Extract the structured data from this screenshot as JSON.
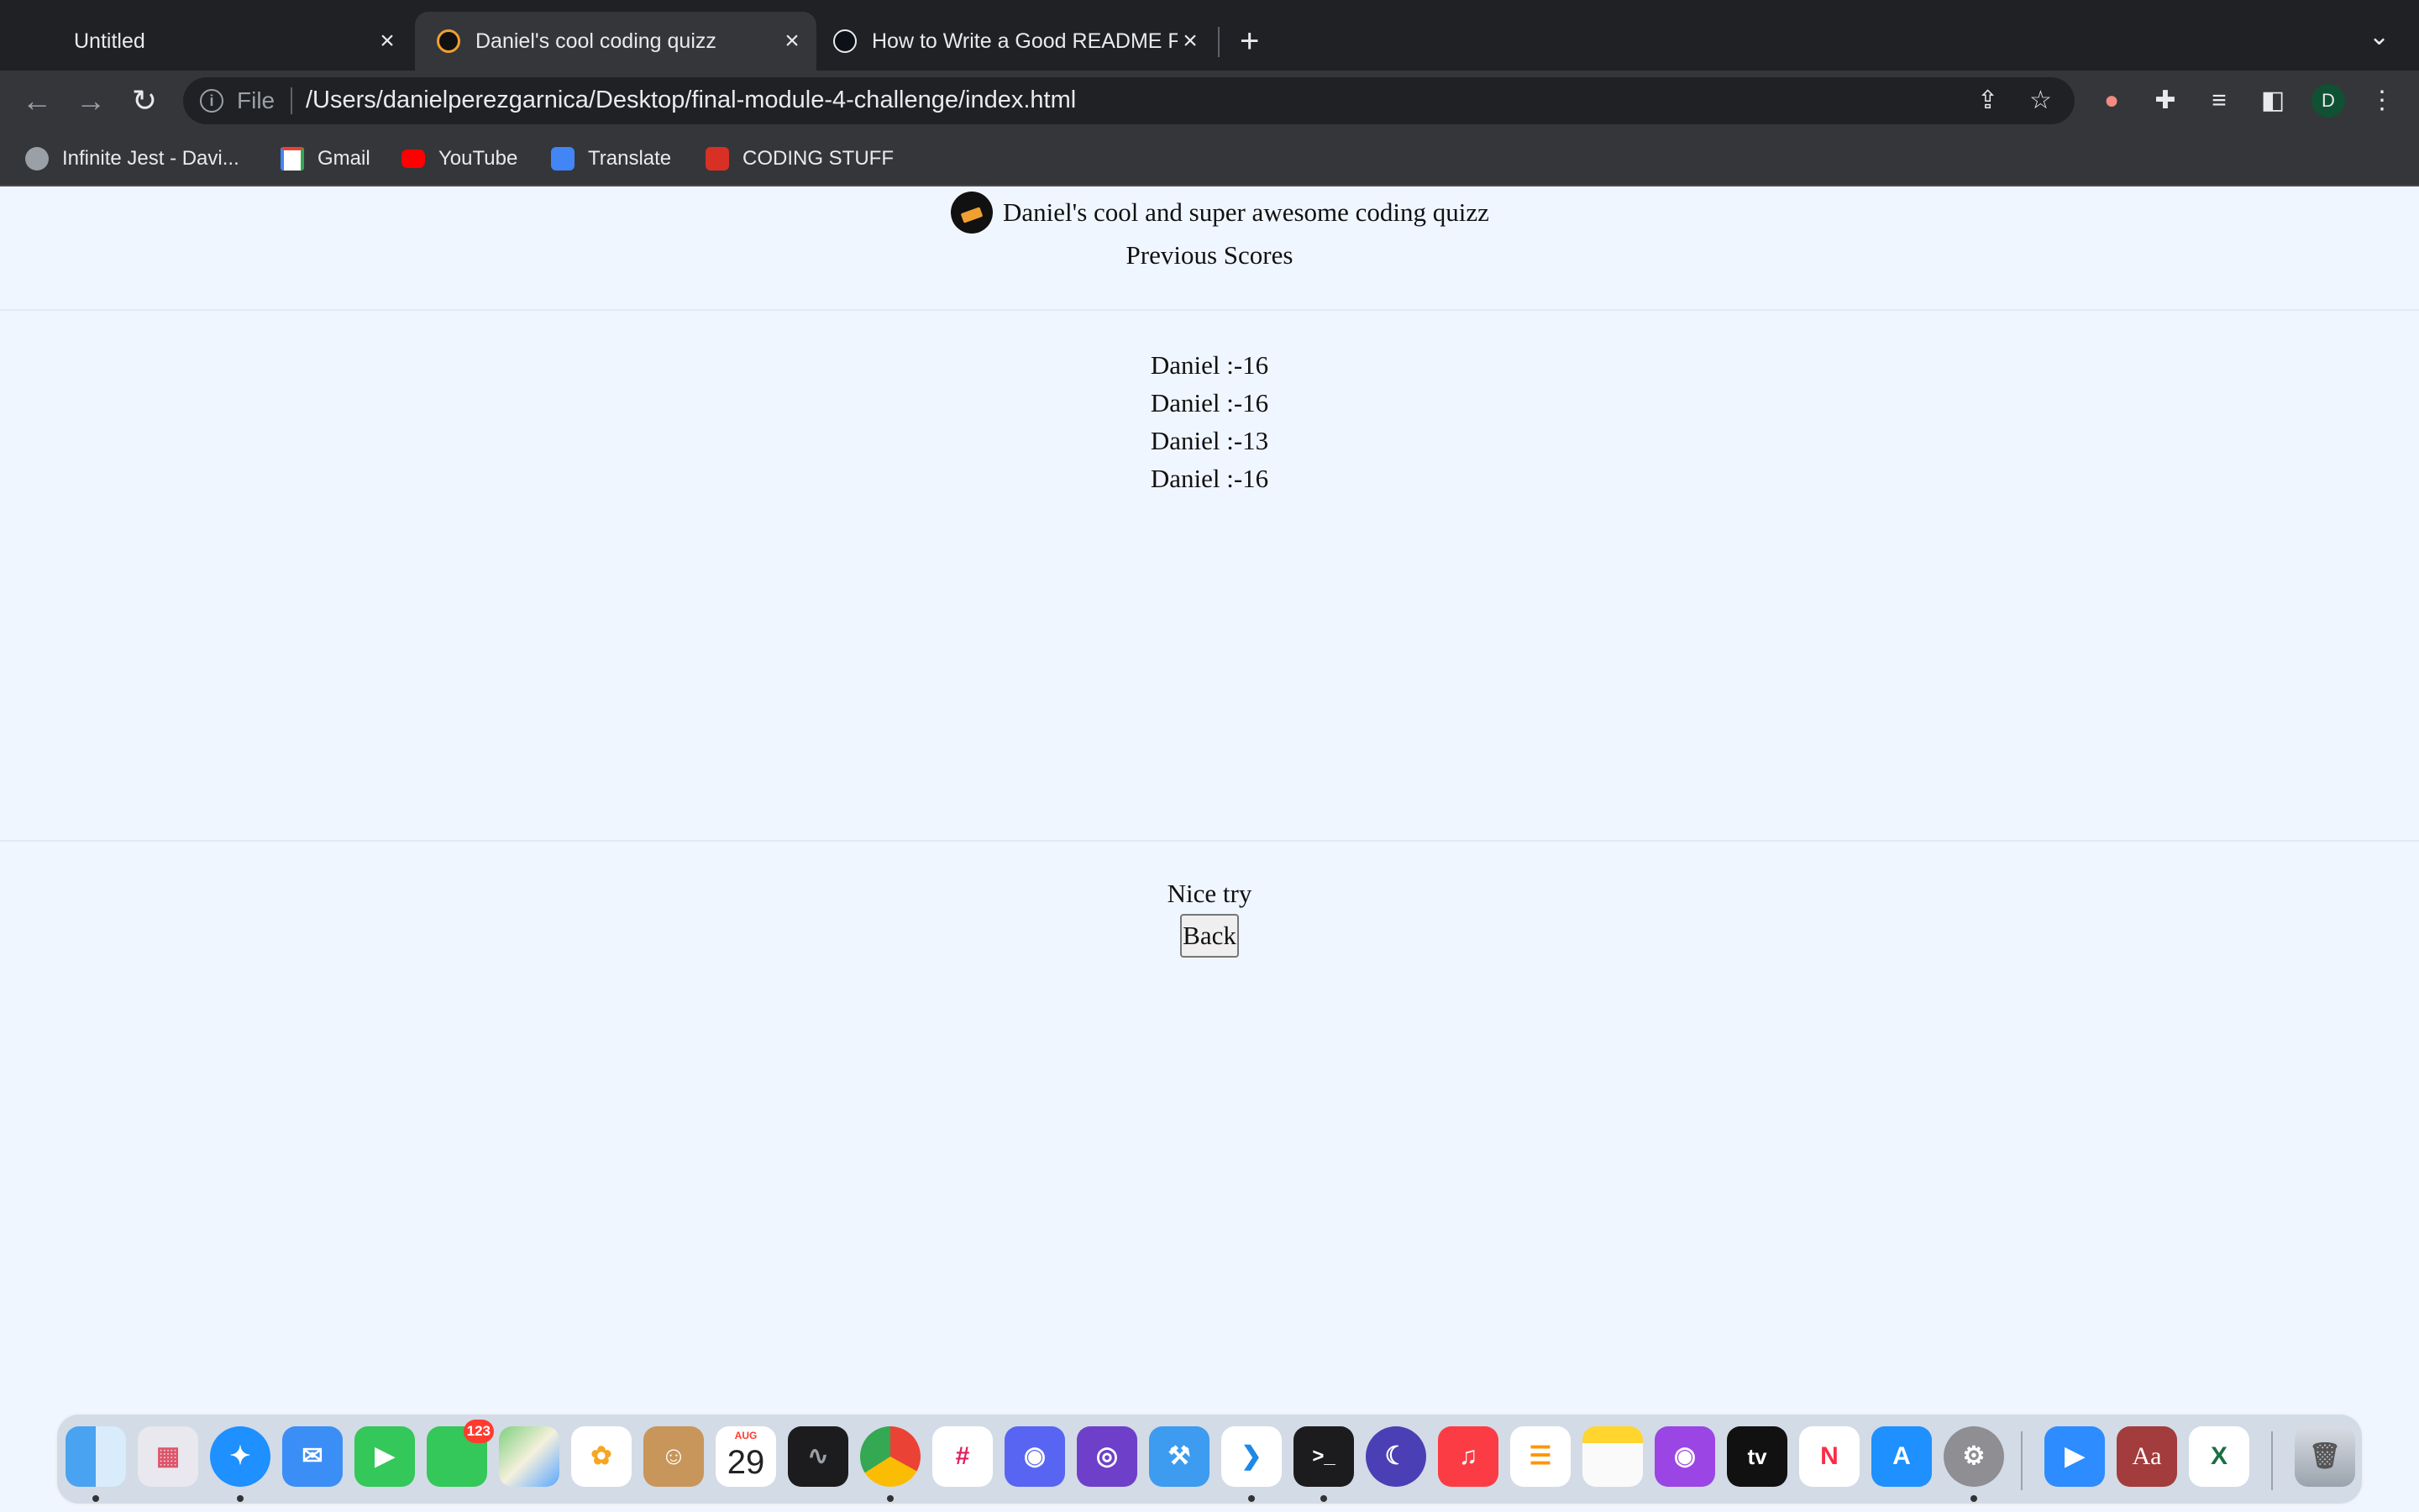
{
  "browser": {
    "tabs": [
      {
        "title": "Untitled"
      },
      {
        "title": "Daniel's cool coding quizz"
      },
      {
        "title": "How to Write a Good README File"
      }
    ],
    "new_tab_label": "+",
    "omnibox": {
      "scheme": "File",
      "url": "/Users/danielperezgarnica/Desktop/final-module-4-challenge/index.html"
    },
    "profile_initial": "D",
    "bookmarks": [
      {
        "label": "Infinite Jest - Davi...",
        "icon": "globe-icon"
      },
      {
        "label": "Gmail",
        "icon": "gmail-icon"
      },
      {
        "label": "YouTube",
        "icon": "youtube-icon"
      },
      {
        "label": "Translate",
        "icon": "translate-icon"
      },
      {
        "label": "CODING STUFF",
        "icon": "folder-icon"
      }
    ]
  },
  "page": {
    "site_title": "Daniel's cool and super awesome coding quizz",
    "section_title": "Previous Scores",
    "scores": [
      "Daniel :-16",
      "Daniel :-16",
      "Daniel :-13",
      "Daniel :-16"
    ],
    "result_message": "Nice try",
    "back_label": "Back"
  },
  "dock": {
    "messages_badge": "123",
    "calendar": {
      "month": "AUG",
      "day": "29"
    },
    "dictionary_label": "Aa",
    "excel_label": "X",
    "tv_label": "tv",
    "terminal_label": ">_"
  },
  "colors": {
    "page_background": "#f0f6ff",
    "chrome_dark": "#202124",
    "chrome_toolbar": "#35363a"
  }
}
